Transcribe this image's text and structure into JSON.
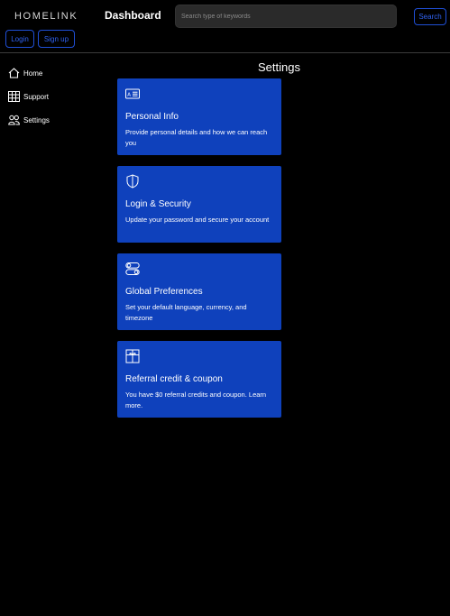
{
  "header": {
    "logo": "HOMELINK",
    "title": "Dashboard",
    "search_placeholder": "Search type of keywords",
    "search_label": "Search",
    "login_label": "Login",
    "signup_label": "Sign up"
  },
  "sidebar": {
    "items": [
      {
        "label": "Home",
        "icon": "home-icon"
      },
      {
        "label": "Support",
        "icon": "table-icon"
      },
      {
        "label": "Settings",
        "icon": "people-icon"
      }
    ]
  },
  "main": {
    "title": "Settings",
    "cards": [
      {
        "title": "Personal Info",
        "description": "Provide personal details and how we can reach you",
        "icon": "id-card-icon"
      },
      {
        "title": "Login & Security",
        "description": "Update your password and secure your account",
        "icon": "shield-icon"
      },
      {
        "title": "Global Preferences",
        "description": "Set your default language, currency, and timezone",
        "icon": "toggles-icon"
      },
      {
        "title": "Referral credit & coupon",
        "description": "You have $0 referral credits and coupon. Learn more.",
        "icon": "gift-icon"
      }
    ]
  },
  "colors": {
    "background": "#000000",
    "card": "#0f41bc",
    "accent": "#2f62f0",
    "search_field": "#2a2a2a"
  }
}
